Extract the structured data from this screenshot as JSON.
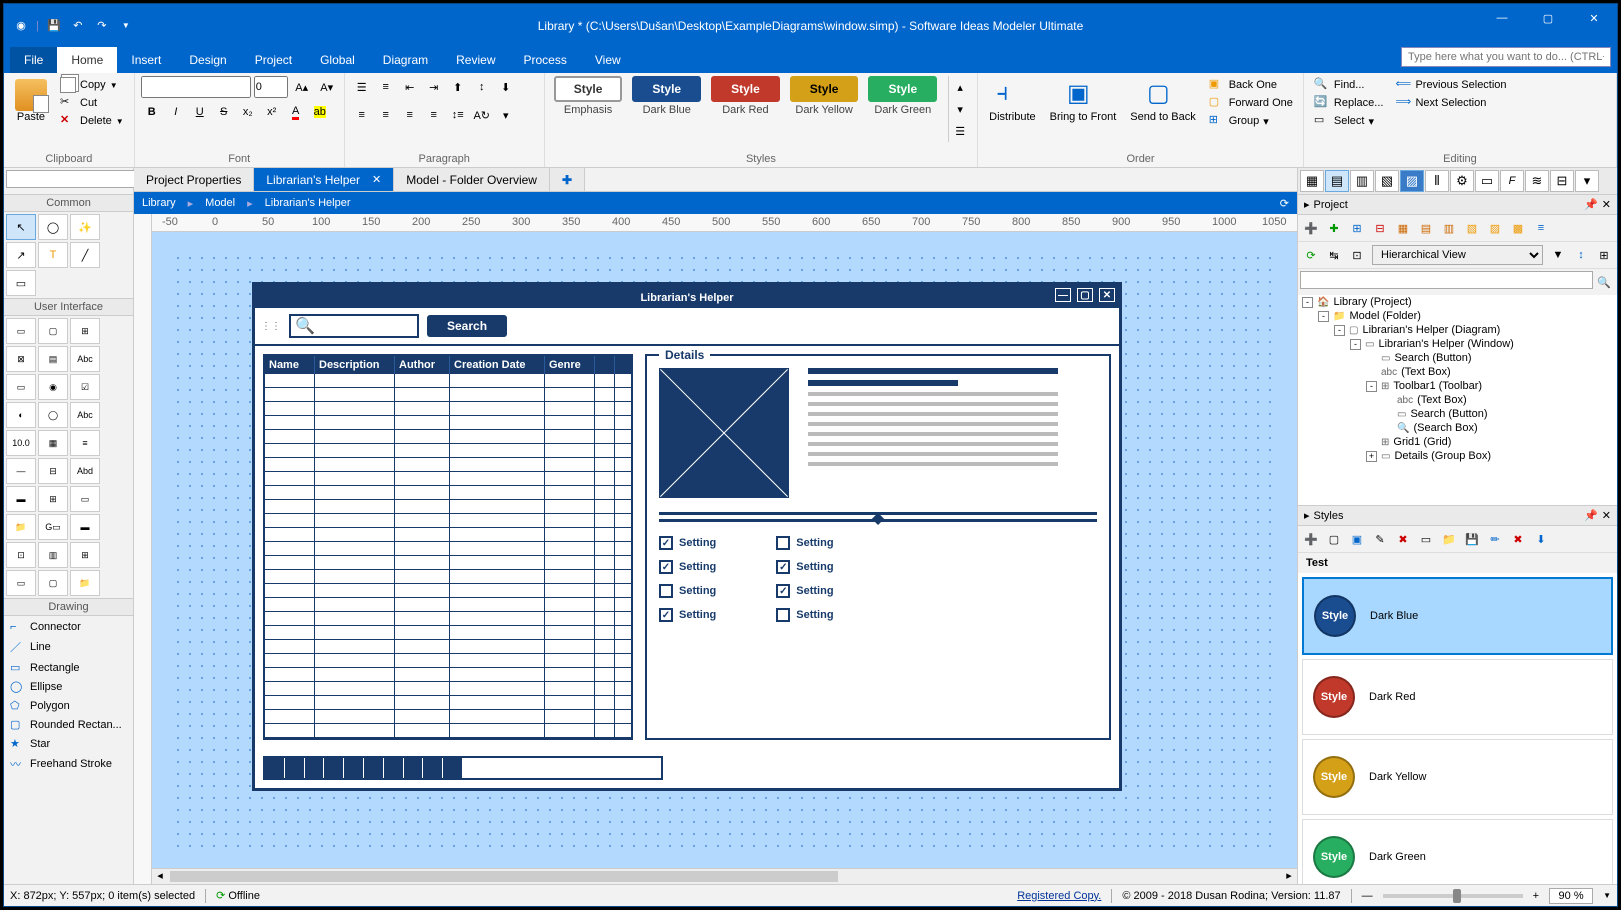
{
  "title": "Library * (C:\\Users\\Dušan\\Desktop\\ExampleDiagrams\\window.simp) - Software Ideas Modeler Ultimate",
  "menubar": {
    "items": [
      "File",
      "Home",
      "Insert",
      "Design",
      "Project",
      "Global",
      "Diagram",
      "Review",
      "Process",
      "View"
    ],
    "active": "Home",
    "search_placeholder": "Type here what you want to do... (CTRL+Q)"
  },
  "ribbon": {
    "clipboard": {
      "paste": "Paste",
      "copy": "Copy",
      "cut": "Cut",
      "delete": "Delete",
      "label": "Clipboard"
    },
    "font": {
      "size": "0",
      "label": "Font"
    },
    "paragraph": {
      "label": "Paragraph"
    },
    "styles": {
      "label": "Styles",
      "items": [
        {
          "name": "Emphasis",
          "bg": "#fff",
          "fg": "#333",
          "border": "#999"
        },
        {
          "name": "Dark Blue",
          "bg": "#1a4d8f",
          "fg": "#fff",
          "border": "#1a4d8f"
        },
        {
          "name": "Dark Red",
          "bg": "#c0392b",
          "fg": "#fff",
          "border": "#c0392b"
        },
        {
          "name": "Dark Yellow",
          "bg": "#d4a017",
          "fg": "#000",
          "border": "#d4a017"
        },
        {
          "name": "Dark Green",
          "bg": "#27ae60",
          "fg": "#fff",
          "border": "#27ae60"
        }
      ]
    },
    "order": {
      "distribute": "Distribute",
      "bring": "Bring to Front",
      "send": "Send to Back",
      "back_one": "Back One",
      "forward_one": "Forward One",
      "group": "Group",
      "label": "Order"
    },
    "editing": {
      "find": "Find...",
      "replace": "Replace...",
      "select": "Select",
      "prev": "Previous Selection",
      "next": "Next Selection",
      "label": "Editing"
    }
  },
  "doc_tabs": [
    {
      "label": "Project Properties",
      "active": false
    },
    {
      "label": "Librarian's Helper",
      "active": true,
      "closable": true
    },
    {
      "label": "Model - Folder Overview",
      "active": false
    }
  ],
  "breadcrumb": [
    "Library",
    "Model",
    "Librarian's Helper"
  ],
  "toolbox": {
    "common_label": "Common",
    "ui_label": "User Interface",
    "drawing_label": "Drawing",
    "drawing_items": [
      "Connector",
      "Line",
      "Rectangle",
      "Ellipse",
      "Polygon",
      "Rounded Rectan...",
      "Star",
      "Freehand Stroke"
    ]
  },
  "mock": {
    "title": "Librarian's Helper",
    "search_btn": "Search",
    "grid_cols": [
      "Name",
      "Description",
      "Author",
      "Creation Date",
      "Genre"
    ],
    "details_label": "Details",
    "setting": "Setting",
    "checks_left": [
      true,
      true,
      false,
      true
    ],
    "checks_right": [
      false,
      true,
      true,
      false
    ]
  },
  "project_panel": {
    "title": "Project",
    "view_mode": "Hierarchical View",
    "tree": [
      {
        "d": 0,
        "exp": "-",
        "icon": "🏠",
        "label": "Library (Project)"
      },
      {
        "d": 1,
        "exp": "-",
        "icon": "📁",
        "label": "Model (Folder)"
      },
      {
        "d": 2,
        "exp": "-",
        "icon": "▢",
        "label": "Librarian's Helper (Diagram)"
      },
      {
        "d": 3,
        "exp": "-",
        "icon": "▭",
        "label": "Librarian's Helper (Window)"
      },
      {
        "d": 4,
        "exp": "",
        "icon": "▭",
        "label": "Search (Button)"
      },
      {
        "d": 4,
        "exp": "",
        "icon": "abc",
        "label": "(Text Box)"
      },
      {
        "d": 4,
        "exp": "-",
        "icon": "⊞",
        "label": "Toolbar1 (Toolbar)"
      },
      {
        "d": 5,
        "exp": "",
        "icon": "abc",
        "label": "(Text Box)"
      },
      {
        "d": 5,
        "exp": "",
        "icon": "▭",
        "label": "Search (Button)"
      },
      {
        "d": 5,
        "exp": "",
        "icon": "🔍",
        "label": "(Search Box)"
      },
      {
        "d": 4,
        "exp": "",
        "icon": "⊞",
        "label": "Grid1 (Grid)"
      },
      {
        "d": 4,
        "exp": "+",
        "icon": "▭",
        "label": "Details (Group Box)"
      }
    ]
  },
  "styles_panel": {
    "title": "Styles",
    "group": "Test",
    "items": [
      {
        "name": "Dark Blue",
        "color": "#1a4d8f",
        "sel": true
      },
      {
        "name": "Dark Red",
        "color": "#c0392b",
        "sel": false
      },
      {
        "name": "Dark Yellow",
        "color": "#d4a017",
        "sel": false
      },
      {
        "name": "Dark Green",
        "color": "#27ae60",
        "sel": false
      }
    ]
  },
  "status": {
    "coords": "X: 872px; Y: 557px; 0 item(s) selected",
    "offline": "Offline",
    "registered": "Registered Copy.",
    "copyright": "© 2009 - 2018 Dusan Rodina; Version: 11.87",
    "zoom": "90 %"
  }
}
